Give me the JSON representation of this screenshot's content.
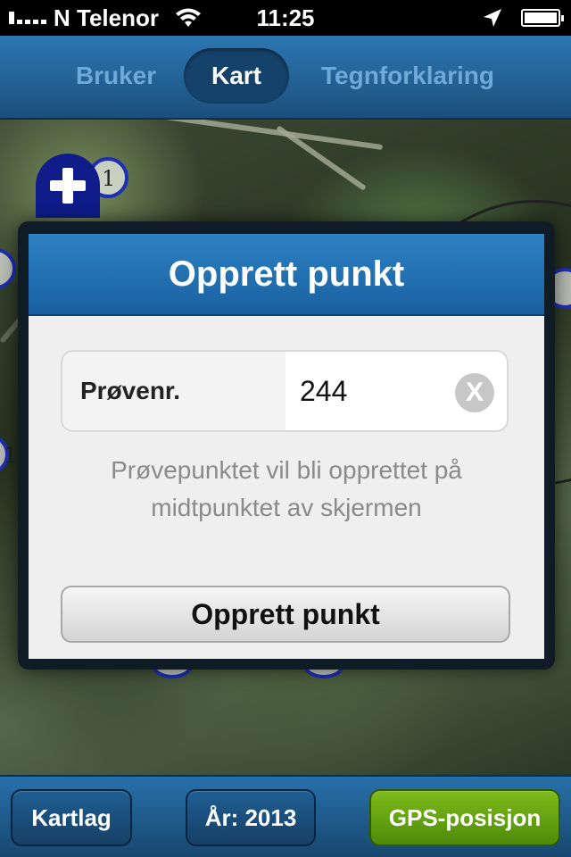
{
  "status_bar": {
    "carrier": "N Telenor",
    "time": "11:25",
    "signal_bars": 1,
    "battery_level": 1.0,
    "icons": [
      "signal-icon",
      "wifi-icon",
      "location-arrow-icon",
      "battery-icon"
    ]
  },
  "tabs": [
    {
      "label": "Bruker",
      "active": false
    },
    {
      "label": "Kart",
      "active": true
    },
    {
      "label": "Tegnforklaring",
      "active": false
    }
  ],
  "map": {
    "markers": [
      "1",
      "1"
    ],
    "add_icon": "plus-icon"
  },
  "dialog": {
    "title": "Opprett punkt",
    "field_label": "Prøvenr.",
    "field_value": "244",
    "clear_icon": "X",
    "helper_line1": "Prøvepunktet vil bli opprettet på",
    "helper_line2": "midtpunktet av skjermen",
    "submit_label": "Opprett punkt"
  },
  "bottom_bar": {
    "layers_label": "Kartlag",
    "year_label": "År: 2013",
    "gps_label": "GPS-posisjon"
  },
  "colors": {
    "nav_blue": "#2d77b2",
    "dialog_header": "#1a60a0",
    "gps_green": "#6aa812",
    "marker_blue": "#0f1c8a"
  }
}
